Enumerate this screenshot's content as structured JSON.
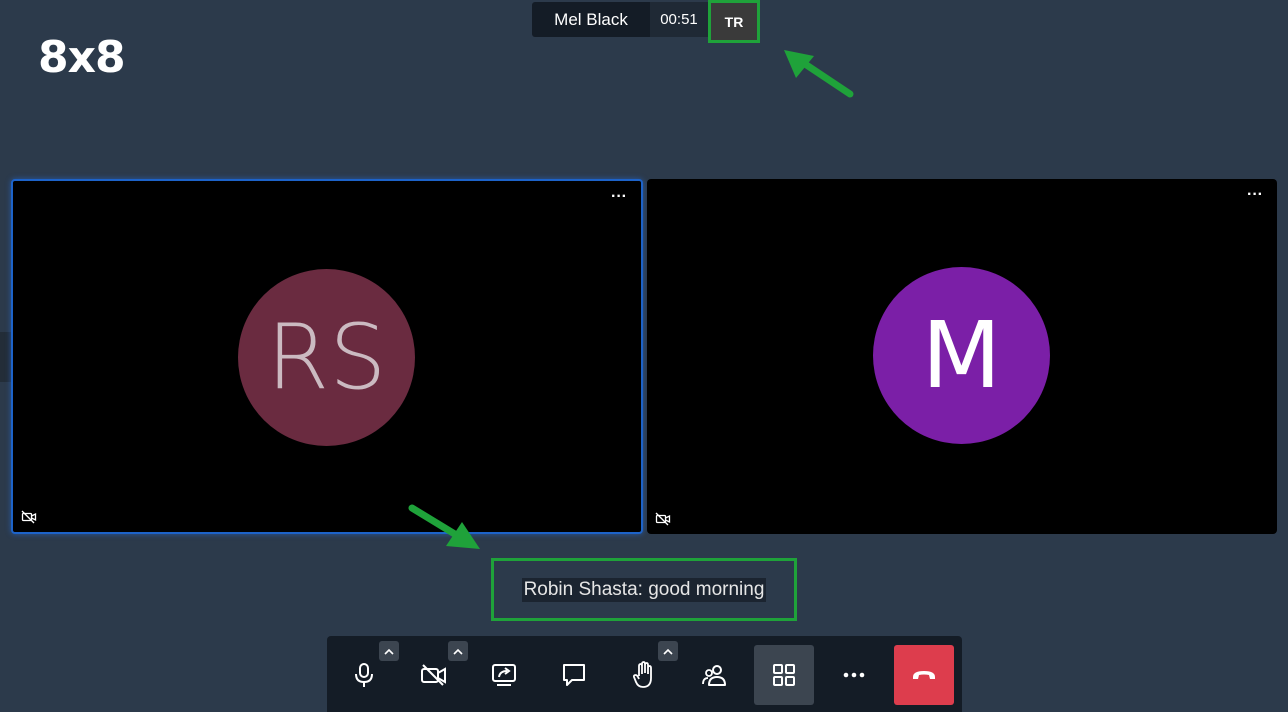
{
  "logo": {
    "text": "8x8"
  },
  "subject": {
    "participant_name": "Mel Black",
    "timer": "00:51",
    "badge": "TR"
  },
  "participants": [
    {
      "initials": "RS",
      "avatar_color": "#6a2b40",
      "menu_label": "···"
    },
    {
      "initials": "M",
      "avatar_color": "#7b1fa7",
      "menu_label": "···"
    }
  ],
  "subtitle": {
    "text": "Robin Shasta: good morning"
  },
  "toolbar": {
    "buttons": [
      {
        "icon": "microphone-icon",
        "has_caret": true
      },
      {
        "icon": "camera-off-icon",
        "has_caret": true
      },
      {
        "icon": "screen-share-icon",
        "has_caret": false
      },
      {
        "icon": "chat-icon",
        "has_caret": false
      },
      {
        "icon": "raise-hand-icon",
        "has_caret": true
      },
      {
        "icon": "participants-icon",
        "has_caret": false
      },
      {
        "icon": "tile-view-icon",
        "has_caret": false
      },
      {
        "icon": "more-options-icon",
        "has_caret": false
      },
      {
        "icon": "hangup-icon",
        "has_caret": false
      }
    ],
    "hangup_color": "#dd3d4d"
  },
  "annotation_color": "#1fa23a"
}
